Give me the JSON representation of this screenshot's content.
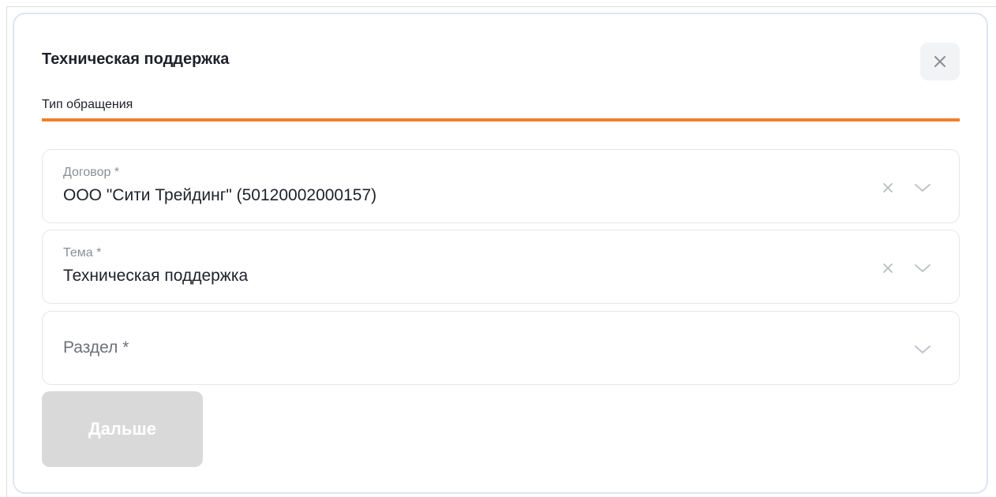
{
  "modal": {
    "title": "Техническая поддержка",
    "close_icon": "close-icon"
  },
  "step": {
    "label": "Тип обращения",
    "accent_color": "#f37f28"
  },
  "fields": [
    {
      "label": "Договор *",
      "value": "ООО \"Сити Трейдинг\" (50120002000157)",
      "clear_icon": "clear-icon",
      "expand_icon": "chevron-down-icon"
    },
    {
      "label": "Тема *",
      "value": "Техническая поддержка",
      "clear_icon": "clear-icon",
      "expand_icon": "chevron-down-icon"
    },
    {
      "label": "Раздел *",
      "value": "",
      "expand_icon": "chevron-down-icon"
    }
  ],
  "actions": {
    "next_label": "Дальше",
    "next_disabled": true
  }
}
